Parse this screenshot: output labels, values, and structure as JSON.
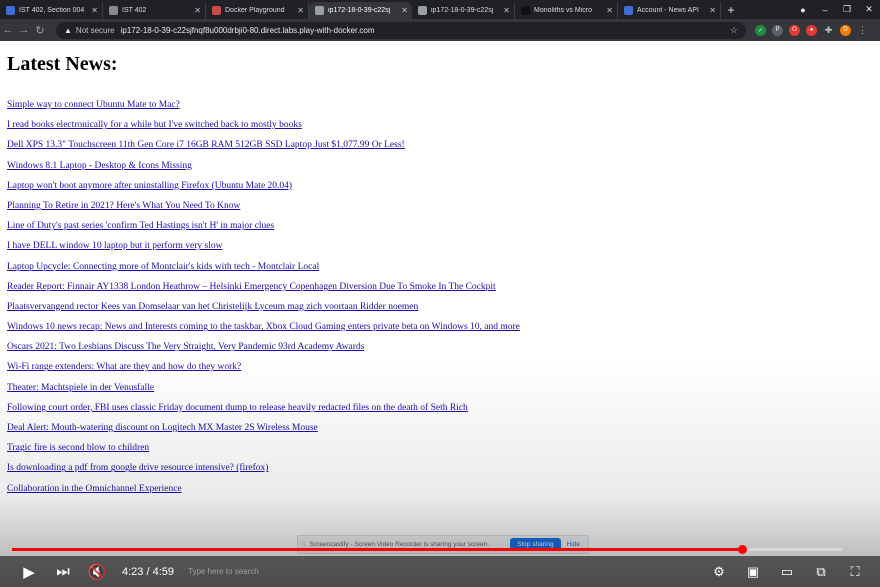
{
  "browser": {
    "tabs": [
      {
        "title": "IST 402, Section 004",
        "favicon_color": "#3c6fd8",
        "active": false
      },
      {
        "title": "IST 402",
        "favicon_color": "#8a8a8a",
        "active": false
      },
      {
        "title": "Docker Playground",
        "favicon_color": "#c94a4a",
        "active": false
      },
      {
        "title": "ip172-18-0-39-c22sj",
        "favicon_color": "#9aa0a6",
        "active": true
      },
      {
        "title": "ip172-18-0-39-c22sj",
        "favicon_color": "#9aa0a6",
        "active": false
      },
      {
        "title": "Monoliths vs Micro",
        "favicon_color": "#111111",
        "active": false
      },
      {
        "title": "Account - News API",
        "favicon_color": "#3c6fd8",
        "active": false
      }
    ],
    "address": {
      "security_label": "Not secure",
      "url": "ip172-18-0-39-c22sjfnqf8u000drbji0-80.direct.labs.play-with-docker.com"
    }
  },
  "page": {
    "title": "Latest News:",
    "articles": [
      "Simple way to connect Ubuntu Mate to Mac?",
      "I read books electronically for a while but I've switched back to mostly books",
      "Dell XPS 13.3\" Touchscreen 11th Gen Core i7 16GB RAM 512GB SSD Laptop Just $1,077.99 Or Less!",
      "Windows 8.1 Laptop - Desktop & Icons Missing",
      "Laptop won't boot anymore after uninstalling Firefox (Ubuntu Mate 20.04)",
      "Planning To Retire in 2021? Here's What You Need To Know",
      "Line of Duty's past series 'confirm Ted Hastings isn't H' in major clues",
      "I have DELL window 10 laptop but it perform very slow",
      "Laptop Upcycle: Connecting more of Montclair's kids with tech - Montclair Local",
      "Reader Report: Finnair AY1338 London Heathrow – Helsinki Emergency Copenhagen Diversion Due To Smoke In The Cockpit",
      "Plaatsvervangend rector Kees van Domselaar van het Christelijk Lyceum mag zich voortaan Ridder noemen",
      "Windows 10 news recap: News and Interests coming to the taskbar, Xbox Cloud Gaming enters private beta on Windows 10, and more",
      "Oscars 2021: Two Lesbians Discuss The Very Straight, Very Pandemic 93rd Academy Awards",
      "Wi-Fi range extenders: What are they and how do they work?",
      "Theater: Machtspiele in der Venusfalle",
      "Following court order, FBI uses classic Friday document dump to release heavily redacted files on the death of Seth Rich",
      "Deal Alert: Mouth-watering discount on Logitech MX Master 2S Wireless Mouse",
      "Tragic fire is second blow to children",
      "Is downloading a pdf from google drive resource intensive? (firefox)",
      "Collaboration in the Omnichannel Experience"
    ]
  },
  "sharebar": {
    "message": "Screencastify - Screen Video Recorder is sharing your screen.",
    "stop_label": "Stop sharing",
    "hide_label": "Hide"
  },
  "player": {
    "time_display": "4:23 / 4:59",
    "progress": 0.88,
    "taskbar_search_ghost": "Type here to search",
    "accent_color": "#ff0000"
  }
}
